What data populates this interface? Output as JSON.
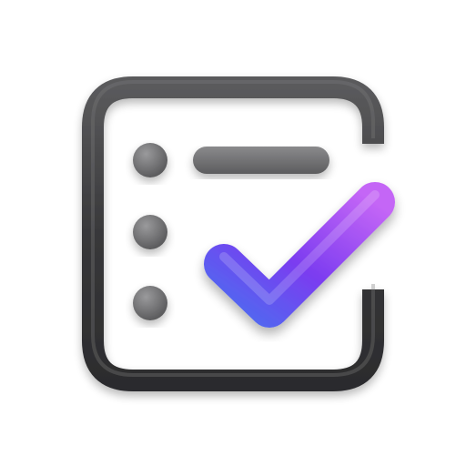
{
  "icon": {
    "name": "task-checklist-icon",
    "frame_color": "#3c3c3e",
    "item_color": "#6e6e70",
    "check_gradient": [
      "#4f6af0",
      "#7b3cf0",
      "#b45cf5"
    ],
    "background": "#ffffff"
  }
}
